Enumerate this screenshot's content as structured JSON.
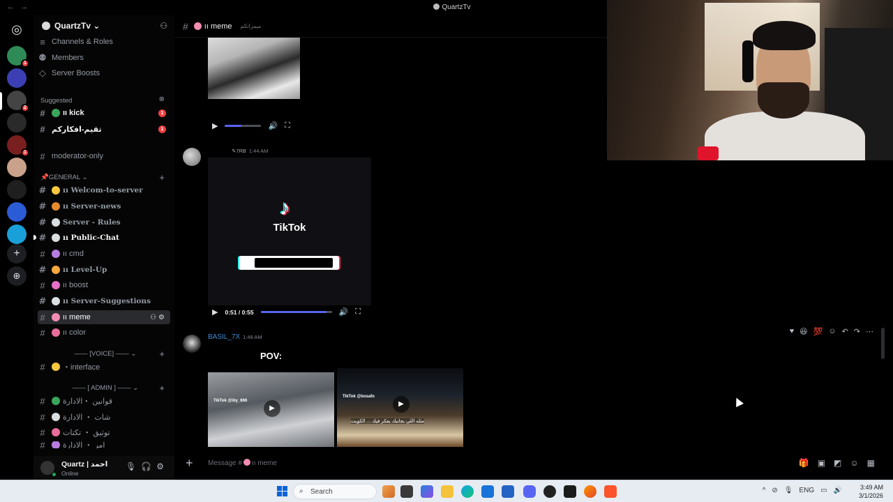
{
  "window": {
    "title": "QuartzTv",
    "nav_back": "←",
    "nav_forward": "→"
  },
  "server_rail": {
    "items": [
      {
        "name": "home",
        "color": "#5865f2",
        "glyph": "◉"
      },
      {
        "name": "server-1",
        "color": "#2e8b57",
        "badge": "1"
      },
      {
        "name": "server-2",
        "color": "#3b3fb3",
        "badge": ""
      },
      {
        "name": "server-quartz",
        "color": "#444",
        "badge": "2"
      },
      {
        "name": "server-4",
        "color": "#2a2a2a",
        "badge": ""
      },
      {
        "name": "server-5",
        "color": "#7a1f1f",
        "badge": "1"
      },
      {
        "name": "server-6",
        "color": "#caa18b",
        "badge": ""
      },
      {
        "name": "server-7",
        "color": "#1f1f1f",
        "badge": ""
      },
      {
        "name": "server-8",
        "color": "#2c5bd6",
        "badge": ""
      },
      {
        "name": "server-9",
        "color": "#1aa0d8",
        "badge": ""
      }
    ],
    "add_server": "+",
    "discover": "⊕"
  },
  "sidebar": {
    "guild_name": "QuartzTv",
    "top_links": [
      "Channels & Roles",
      "Members",
      "Server Boosts"
    ],
    "suggested_label": "Suggested",
    "suggested": [
      {
        "name": "ıı kick",
        "badge": "1"
      },
      {
        "name": "تقيم-افكاركم",
        "badge": "1"
      }
    ],
    "moderator": "moderator-only",
    "general_label": "GENERAL",
    "general_channels": [
      {
        "name": "ıı Welcom-to-server",
        "emoji_color": "#f7c83e"
      },
      {
        "name": "ıı Server-news",
        "emoji_color": "#e58a2d"
      },
      {
        "name": "Server - Rules",
        "emoji_color": "#dbdee1"
      },
      {
        "name": "ıı Public-Chat",
        "emoji_color": "#dbdee1"
      },
      {
        "name": "ıı cmd",
        "emoji_color": "#b77de0"
      },
      {
        "name": "ıı Level-Up",
        "emoji_color": "#f7a83e"
      },
      {
        "name": "ıı boost",
        "emoji_color": "#e570c9"
      },
      {
        "name": "ıı Server-Suggestions",
        "emoji_color": "#dbdee1"
      },
      {
        "name": "ıı meme",
        "emoji_color": "#f28cb1"
      },
      {
        "name": "ıı color",
        "emoji_color": "#e96d9a"
      }
    ],
    "voice_label": "[VOICE]",
    "voice_channels": [
      {
        "name": "・interface",
        "emoji_color": "#f7c83e"
      }
    ],
    "admin_label": "[ ADMIN ]",
    "admin_channels": [
      "قوانين ・الادارة",
      "شات ・ الادارة",
      "توثيق ・ تكتات",
      "امر ・ الادارة"
    ]
  },
  "user": {
    "name": "Quartz | احمد",
    "status": "Online"
  },
  "chat": {
    "channel_name": "ıı meme",
    "topic": "ميمزاتكم",
    "message1": {
      "author_icon": "🎬",
      "author": "7RB",
      "time": "1:44 AM"
    },
    "tiktok": {
      "brand": "TikTok",
      "note": "♪"
    },
    "player1": {
      "time": "",
      "progress": 0.45
    },
    "player2": {
      "time": "0:51 / 0:55",
      "progress": 0.93
    },
    "message2": {
      "author": "BASIL_7X",
      "time": "1:48 AM",
      "author_color": "#3d8cd6"
    },
    "pov": "POV:",
    "video1": {
      "watermark": "TikTok\n@iby_666"
    },
    "video2": {
      "watermark": "TikTok\n@bosafo",
      "caption": "مثله اللي بجانبك يفكر فيك ... الكويت"
    },
    "reactions": [
      "♥",
      "😆",
      "💯"
    ],
    "composer_placeholder_prefix": "Message #",
    "composer_placeholder_channel": "ıı meme"
  },
  "taskbar": {
    "search_label": "Search",
    "lang": "ENG",
    "time": "3:49 AM",
    "date": "3/1/2026"
  }
}
